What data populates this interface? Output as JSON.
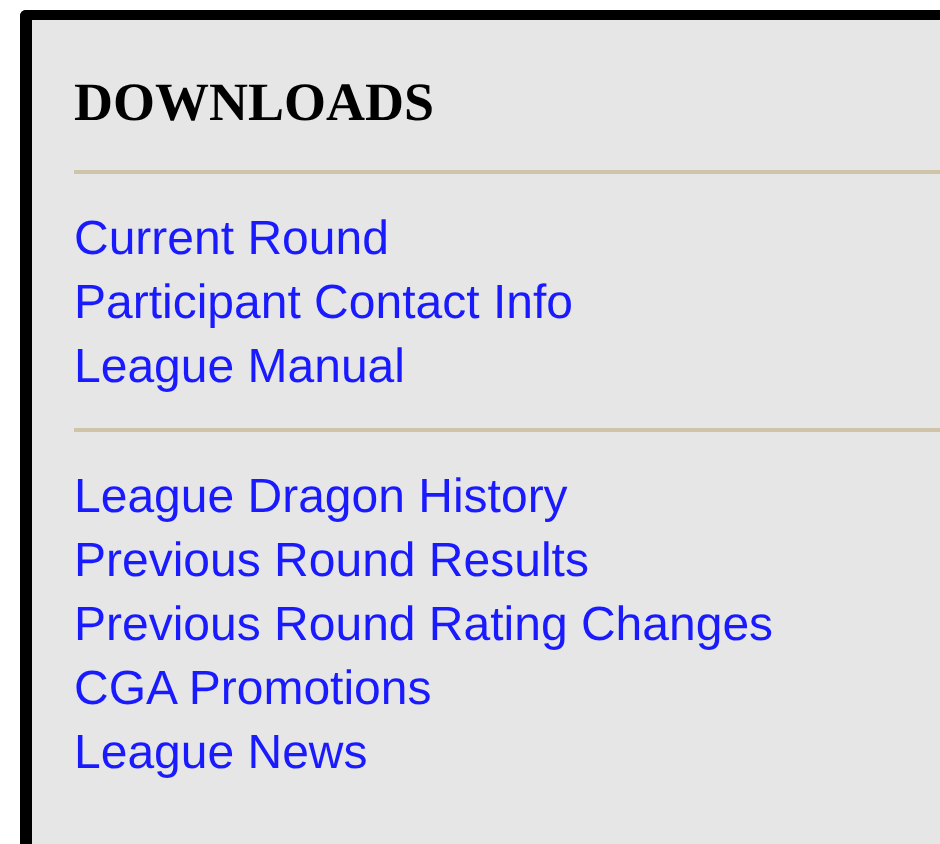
{
  "title": "DOWNLOADS",
  "groups": [
    {
      "links": [
        "Current Round",
        "Participant Contact Info",
        "League Manual"
      ]
    },
    {
      "links": [
        "League Dragon History",
        "Previous Round Results",
        "Previous Round Rating Changes",
        "CGA Promotions",
        "League News"
      ]
    }
  ]
}
